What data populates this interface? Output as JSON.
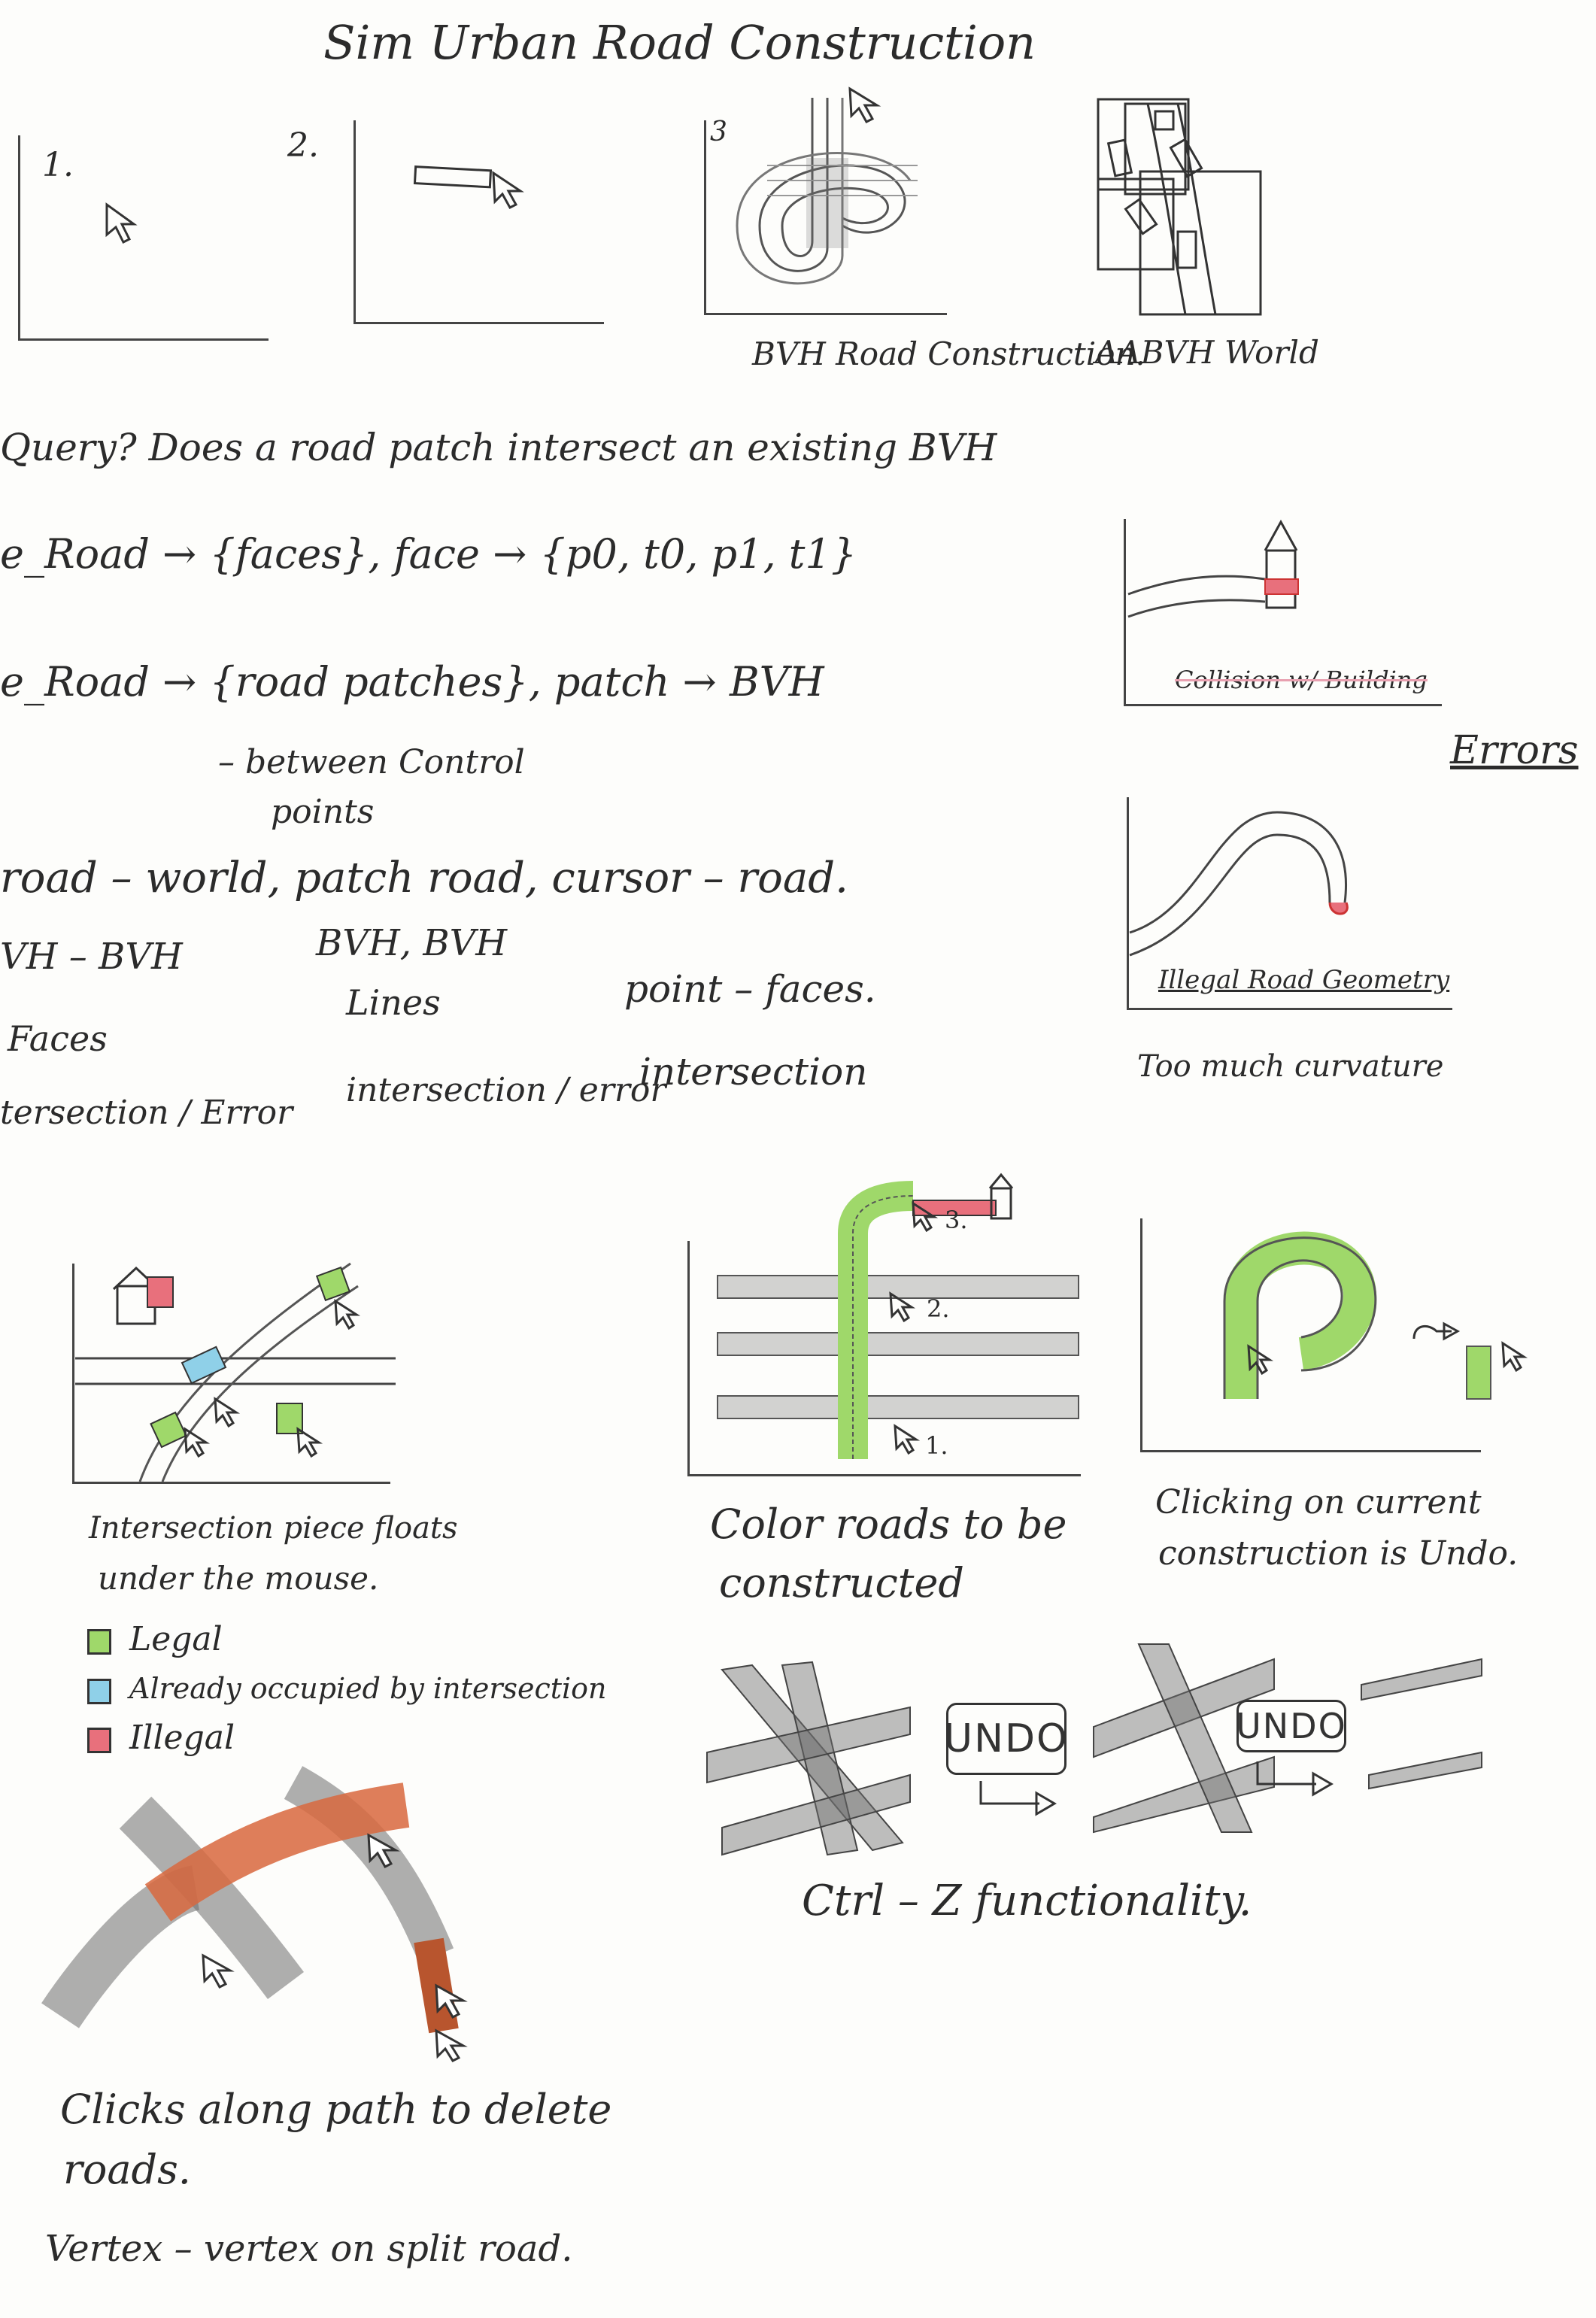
{
  "title": "Sim Urban Road Construction",
  "top_panels": {
    "p1": "1.",
    "p2": "2.",
    "p3": "3",
    "caption_bvh": "BVH Road Construction.",
    "caption_aabvh": "AABVH World"
  },
  "notes": {
    "query": "Query? Does a road patch intersect an existing BVH",
    "line_road_faces": "e_Road → {faces}, face → {p0, t0, p1, t1}",
    "line_road_patches": "e_Road → {road patches}, patch → BVH",
    "between_control": "– between Control",
    "points": "points",
    "road_world": "road – world, patch road, cursor – road.",
    "vh_bvh": "VH – BVH",
    "bvh_bvh": "BVH, BVH",
    "lines": "Lines",
    "point_faces": "point – faces.",
    "faces": "Faces",
    "intersection_error": "tersection / Error",
    "intersection_error2": "intersection / error",
    "intersection": "intersection"
  },
  "errors": {
    "heading": "Errors",
    "collision_caption": "Collision w/ Building",
    "illegal_caption": "Illegal Road Geometry",
    "too_much": "Too much curvature"
  },
  "middle": {
    "float_caption_1": "Intersection piece floats",
    "float_caption_2": "under the mouse.",
    "color_caption_1": "Color roads to be",
    "color_caption_2": "constructed",
    "step1": "1.",
    "step2": "2.",
    "step3": "3.",
    "undo_caption_1": "Clicking on current",
    "undo_caption_2": "construction is Undo."
  },
  "legend": [
    {
      "label": "Legal",
      "color": "#9fd86a"
    },
    {
      "label": "Already occupied by intersection",
      "color": "#8fd0e8"
    },
    {
      "label": "Illegal",
      "color": "#e8707c"
    }
  ],
  "bottom": {
    "undo_label_1": "UNDO",
    "undo_label_2": "UNDO",
    "ctrl_caption": "Ctrl – Z functionality.",
    "delete_caption_1": "Clicks along path to delete",
    "delete_caption_2": "roads.",
    "vertex_caption": "Vertex – vertex on split road."
  },
  "colors": {
    "legal": "#9fd86a",
    "occupied": "#8fd0e8",
    "illegal": "#e8707c",
    "delete": "#d9693f"
  }
}
